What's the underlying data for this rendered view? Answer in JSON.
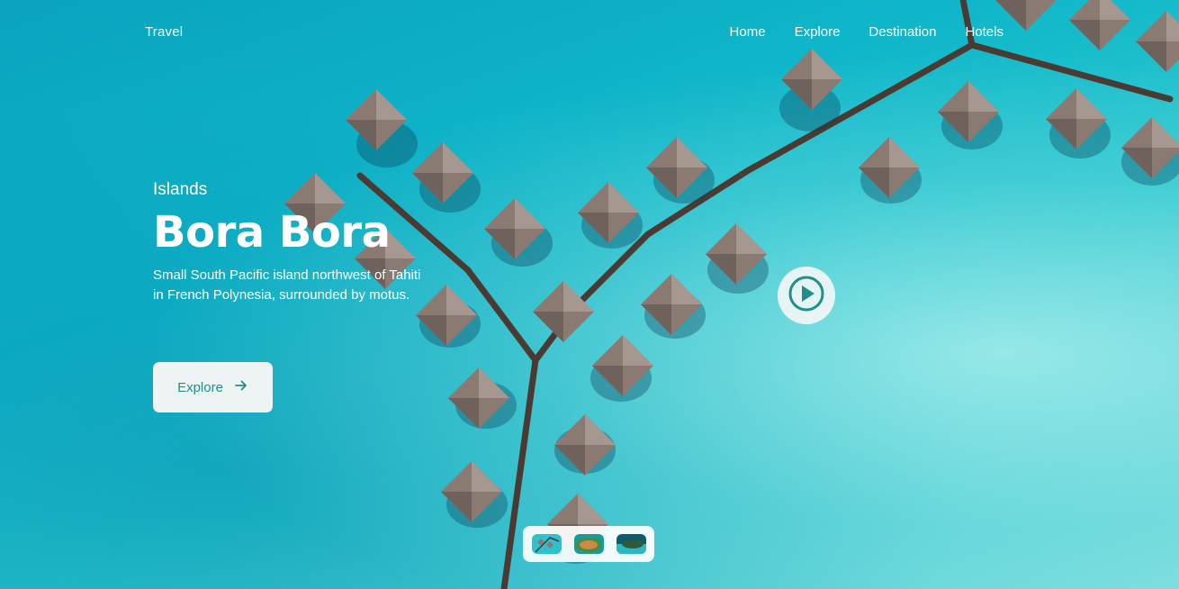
{
  "header": {
    "brand": "Travel",
    "nav": [
      "Home",
      "Explore",
      "Destination",
      "Hotels"
    ]
  },
  "hero": {
    "subtitle": "Islands",
    "title": "Bora Bora",
    "description": "Small South Pacific island northwest of Tahiti in French Polynesia, surrounded by motus.",
    "explore_label": "Explore",
    "explore_icon": "arrow-right-icon",
    "play_icon": "play-circle-icon"
  },
  "thumbnails": [
    "overwater-bungalows",
    "green-island",
    "lagoon-island"
  ],
  "colors": {
    "accent": "#1f8f8a",
    "button_bg": "#eef4f4",
    "water": "#0fb6c9"
  }
}
